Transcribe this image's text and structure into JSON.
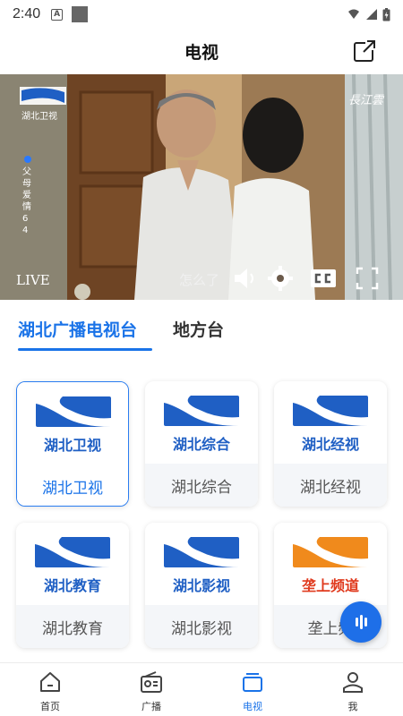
{
  "status_bar": {
    "time": "2:40",
    "notification_icon": "A"
  },
  "header": {
    "title": "电视",
    "share_icon": "external-link-icon"
  },
  "video": {
    "watermark": "長江雲",
    "channel_logo_text": "湖北卫视",
    "program_text": "父母爱情64",
    "live_label": "LIVE",
    "subtitle": "怎么了",
    "controls": [
      "volume-icon",
      "settings-icon",
      "captions-icon",
      "fullscreen-icon"
    ]
  },
  "tabs": [
    {
      "label": "湖北广播电视台",
      "active": true
    },
    {
      "label": "地方台",
      "active": false
    }
  ],
  "channels": [
    {
      "logo_text": "湖北卫视",
      "name": "湖北卫视",
      "selected": true,
      "logo_color": "#1f5fc4"
    },
    {
      "logo_text": "湖北综合",
      "name": "湖北综合",
      "selected": false,
      "logo_color": "#1f5fc4"
    },
    {
      "logo_text": "湖北经视",
      "name": "湖北经视",
      "selected": false,
      "logo_color": "#1f5fc4"
    },
    {
      "logo_text": "湖北教育",
      "name": "湖北教育",
      "selected": false,
      "logo_color": "#1f5fc4"
    },
    {
      "logo_text": "湖北影视",
      "name": "湖北影视",
      "selected": false,
      "logo_color": "#1f5fc4"
    },
    {
      "logo_text": "垄上频道",
      "name": "垄上频",
      "selected": false,
      "logo_color": "#e03a1e"
    }
  ],
  "bottom_nav": [
    {
      "label": "首页",
      "icon": "home-icon",
      "active": false
    },
    {
      "label": "广播",
      "icon": "radio-icon",
      "active": false
    },
    {
      "label": "电视",
      "icon": "tv-icon",
      "active": true
    },
    {
      "label": "我",
      "icon": "profile-icon",
      "active": false
    }
  ],
  "colors": {
    "accent": "#1a73e8",
    "logo_blue": "#1f5fc4",
    "logo_orange": "#e03a1e"
  }
}
